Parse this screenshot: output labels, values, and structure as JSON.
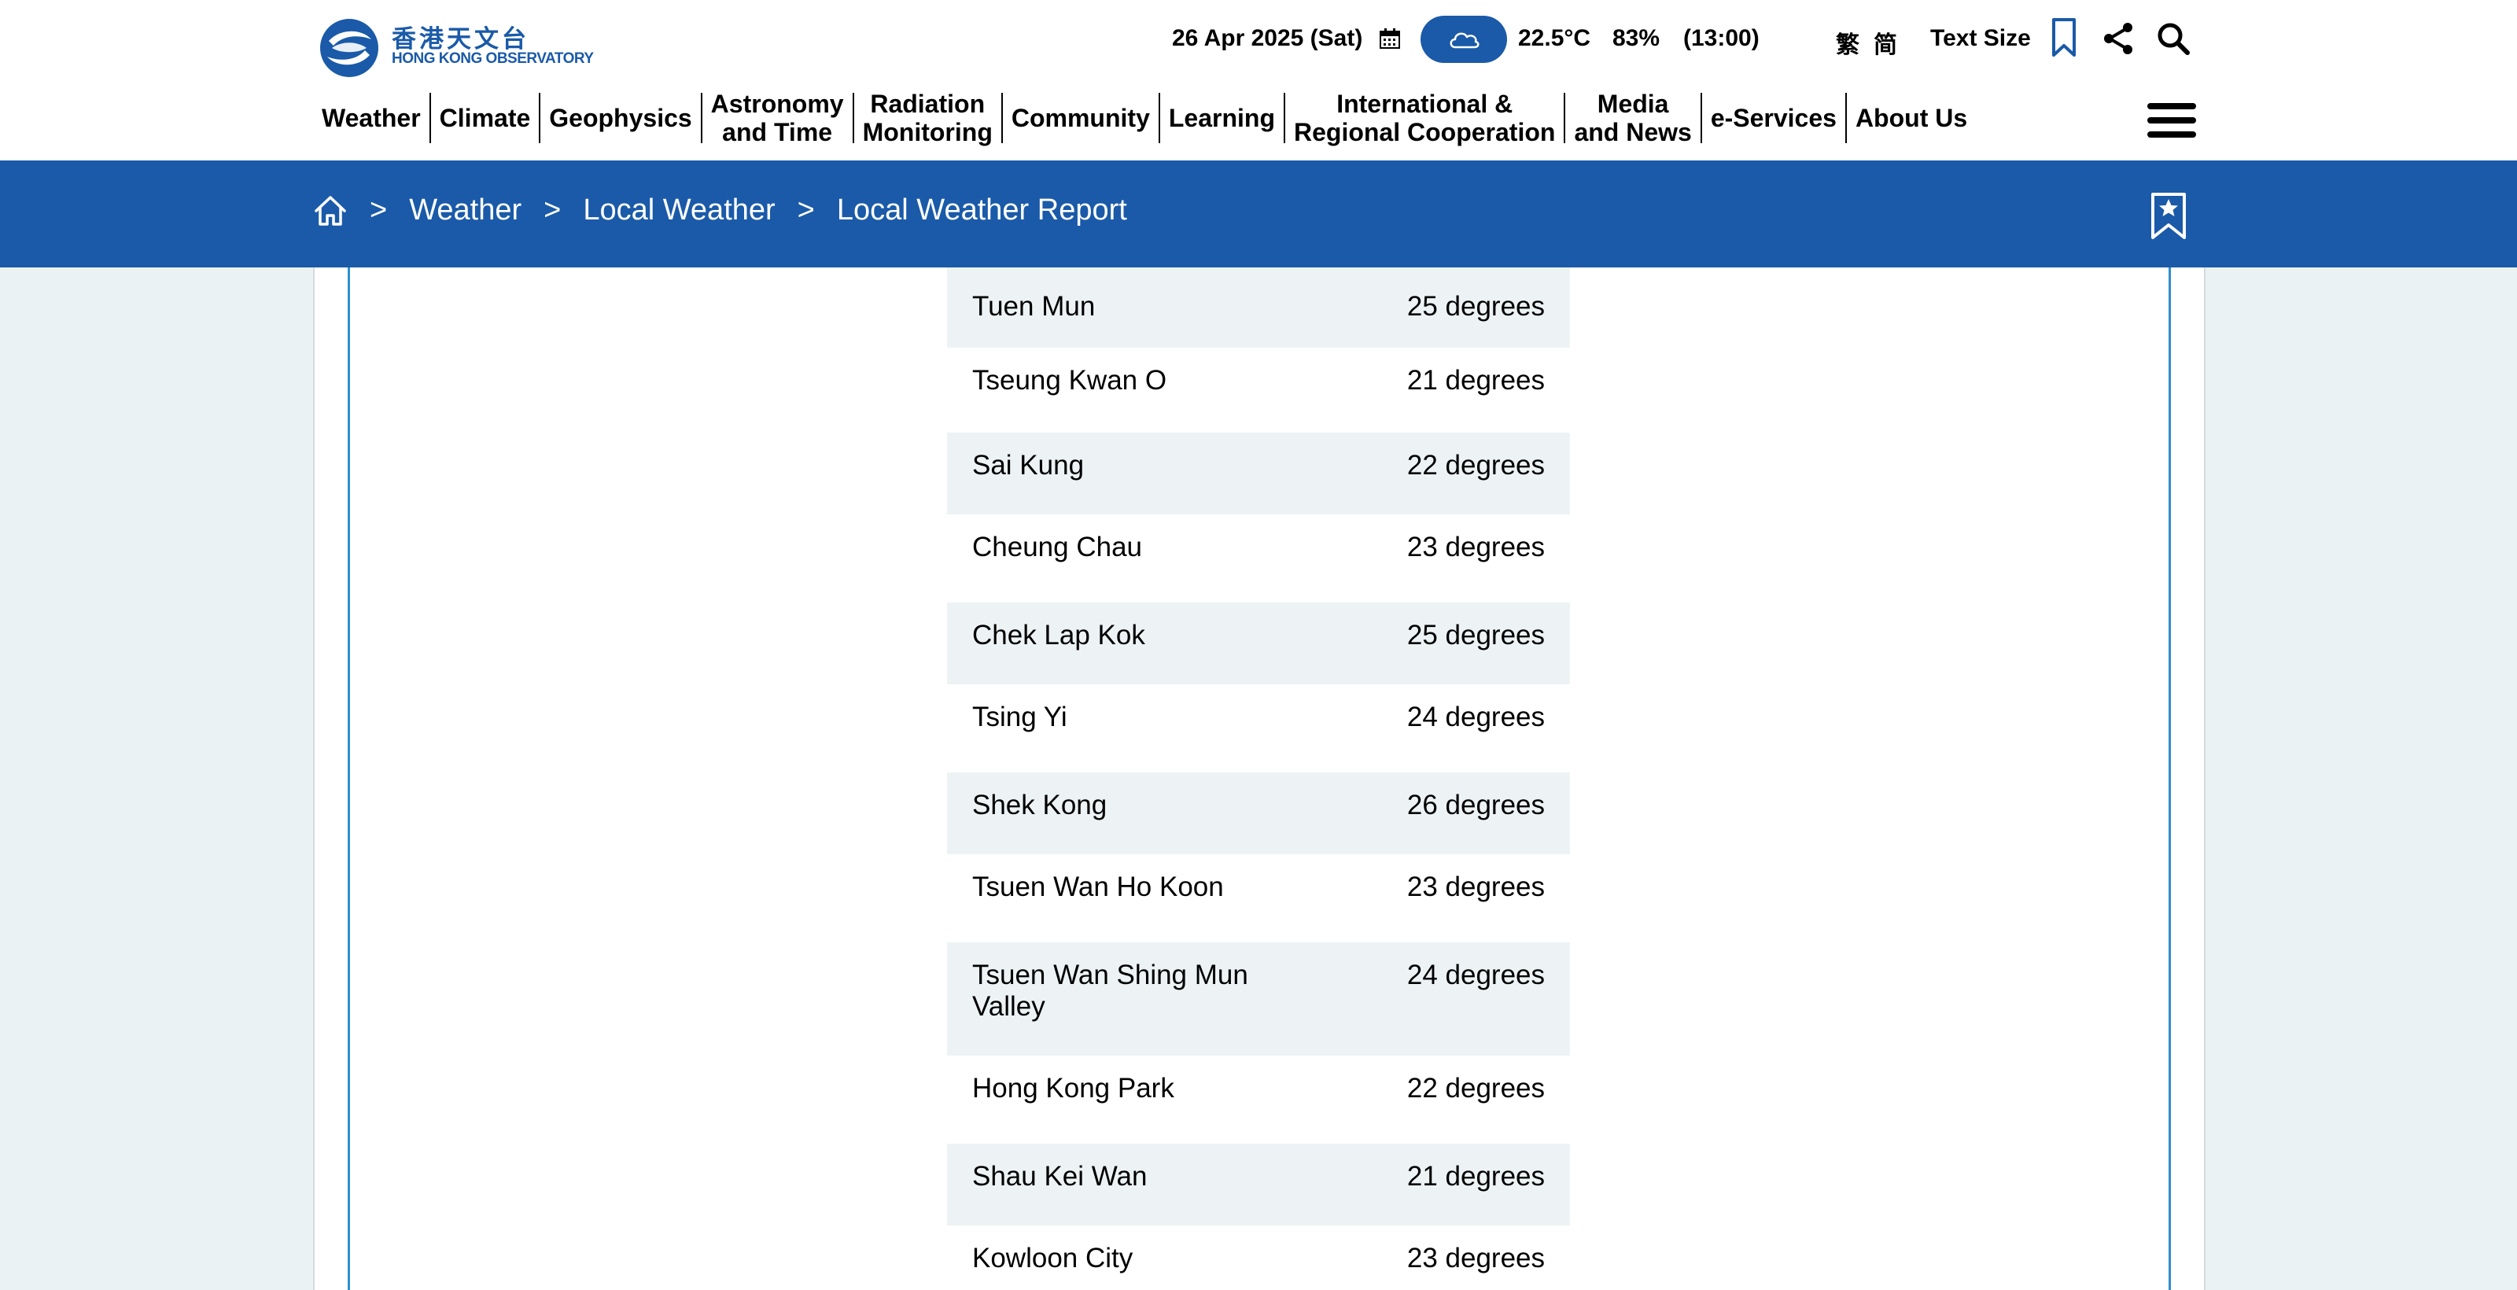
{
  "logo": {
    "chinese": "香港天文台",
    "english": "HONG KONG OBSERVATORY"
  },
  "header": {
    "date": "26 Apr 2025 (Sat)",
    "weather_icon": "cloud-icon",
    "temperature": "22.5°C",
    "humidity": "83%",
    "time": "(13:00)",
    "lang_traditional": "繁",
    "lang_simplified": "简",
    "text_size": "Text Size"
  },
  "nav": {
    "items": [
      {
        "label": "Weather"
      },
      {
        "label": "Climate"
      },
      {
        "label": "Geophysics"
      },
      {
        "label": "Astronomy\nand Time"
      },
      {
        "label": "Radiation\nMonitoring"
      },
      {
        "label": "Community"
      },
      {
        "label": "Learning"
      },
      {
        "label": "International &\nRegional Cooperation"
      },
      {
        "label": "Media\nand News"
      },
      {
        "label": "e-Services"
      },
      {
        "label": "About Us"
      }
    ]
  },
  "breadcrumb": {
    "sep": ">",
    "items": [
      "Weather",
      "Local Weather",
      "Local Weather Report"
    ]
  },
  "temperatures": {
    "rows": [
      {
        "station": "Tuen Mun",
        "value": "25 degrees"
      },
      {
        "station": "Tseung Kwan O",
        "value": "21 degrees"
      },
      {
        "station": "Sai Kung",
        "value": "22 degrees"
      },
      {
        "station": "Cheung Chau",
        "value": "23 degrees"
      },
      {
        "station": "Chek Lap Kok",
        "value": "25 degrees"
      },
      {
        "station": "Tsing Yi",
        "value": "24 degrees"
      },
      {
        "station": "Shek Kong",
        "value": "26 degrees"
      },
      {
        "station": "Tsuen Wan Ho Koon",
        "value": "23 degrees"
      },
      {
        "station": "Tsuen Wan Shing Mun Valley",
        "value": "24 degrees"
      },
      {
        "station": "Hong Kong Park",
        "value": "22 degrees"
      },
      {
        "station": "Shau Kei Wan",
        "value": "21 degrees"
      },
      {
        "station": "Kowloon City",
        "value": "23 degrees"
      }
    ]
  },
  "colors": {
    "brand_blue": "#1a5aa8",
    "row_shade": "#edf3f5",
    "page_bg": "#eaf2f4"
  }
}
